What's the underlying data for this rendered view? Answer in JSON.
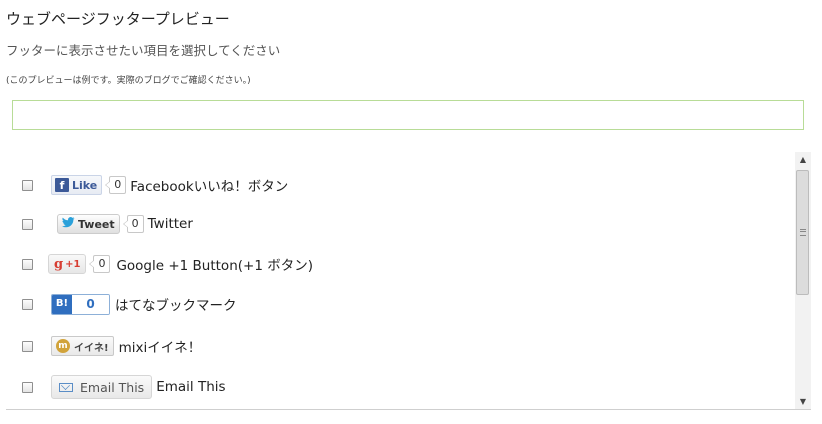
{
  "page": {
    "title": "ウェブページフッタープレビュー",
    "subtitle": "フッターに表示させたい項目を選択してください",
    "note": "(このプレビューは例です。実際のブログでご確認ください。)"
  },
  "items": [
    {
      "label": "Facebookいいね！ボタン",
      "button_text": "Like",
      "count": "0",
      "checked": false
    },
    {
      "label": "Twitter",
      "button_text": "Tweet",
      "count": "0",
      "checked": false
    },
    {
      "label": "Google +1 Button(+1 ボタン)",
      "button_text": "+1",
      "count": "0",
      "checked": false
    },
    {
      "label": "はてなブックマーク",
      "button_text": "B!",
      "count": "0",
      "checked": false
    },
    {
      "label": "mixiイイネ！",
      "button_text": "イイネ!",
      "checked": false
    },
    {
      "label": "Email This",
      "button_text": "Email This",
      "checked": false
    }
  ],
  "icons": {
    "facebook": "f",
    "google": "g",
    "mixi": "m",
    "scroll_up": "▲",
    "scroll_down": "▼"
  },
  "colors": {
    "preview_border": "#b8dc97",
    "facebook": "#3b5998",
    "twitter": "#2ba1da",
    "google": "#d73d32",
    "hatena": "#2f6ebf",
    "mixi": "#d1a33b"
  }
}
